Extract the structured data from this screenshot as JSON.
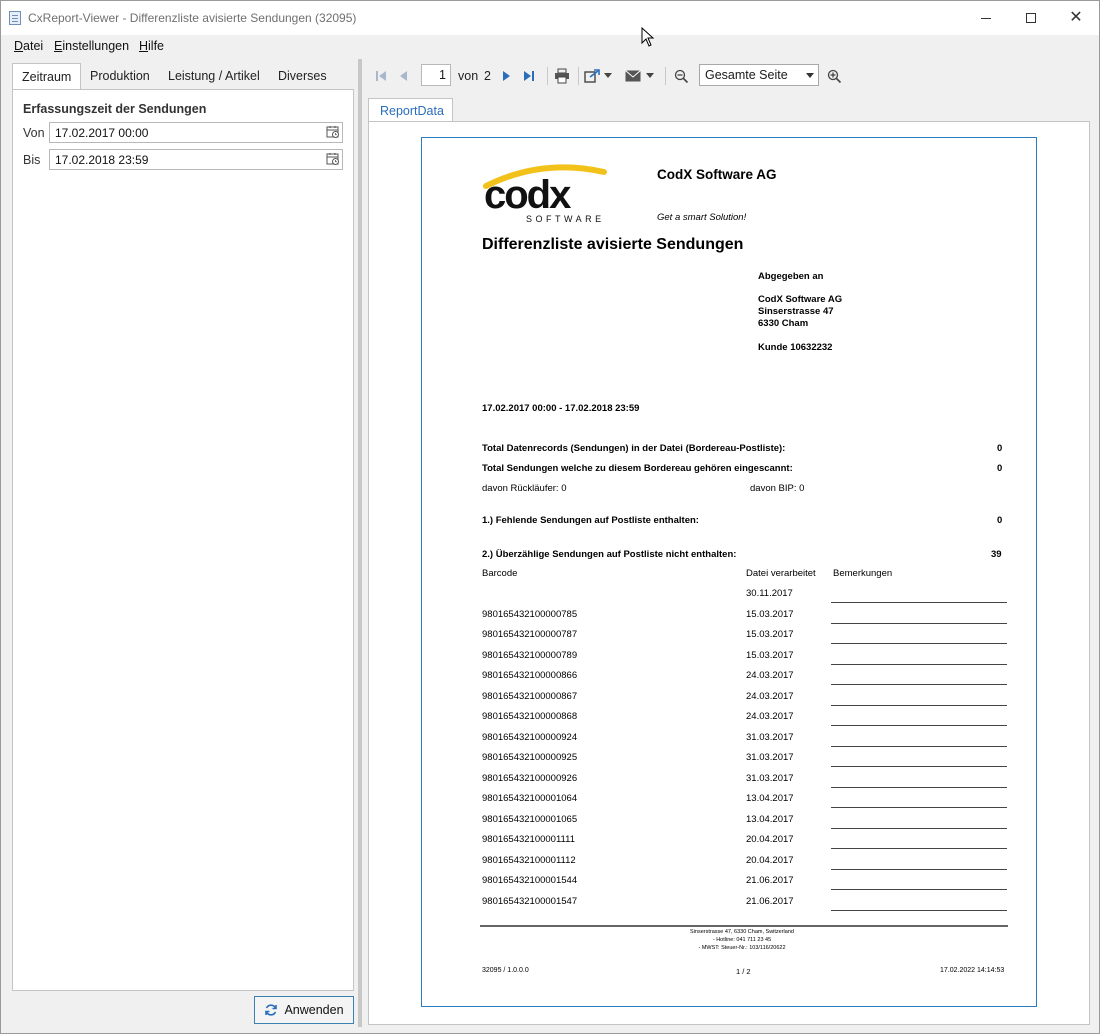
{
  "window": {
    "title": "CxReport-Viewer - Differenzliste avisierte Sendungen (32095)"
  },
  "menu": [
    "Datei",
    "Einstellungen",
    "Hilfe"
  ],
  "left": {
    "tabs": [
      "Zeitraum",
      "Produktion",
      "Leistung / Artikel",
      "Diverses"
    ],
    "group_title": "Erfassungszeit der Sendungen",
    "from_label": "Von",
    "from_value": "17.02.2017 00:00",
    "to_label": "Bis",
    "to_value": "17.02.2018 23:59",
    "apply_label": "Anwenden"
  },
  "toolbar": {
    "page_current": "1",
    "of_label": "von",
    "page_total": "2",
    "zoom_value": "Gesamte Seite"
  },
  "report_tab": "ReportData",
  "report": {
    "company": "CodX Software AG",
    "slogan": "Get a smart Solution!",
    "logo_text": "codx",
    "logo_sub": "SOFTWARE",
    "title": "Differenzliste avisierte Sendungen",
    "delivered_label": "Abgegeben an",
    "addr1": "CodX Software AG",
    "addr2": "Sinserstrasse 47",
    "addr3": "6330 Cham",
    "customer": "Kunde 10632232",
    "period": "17.02.2017 00:00 - 17.02.2018 23:59",
    "total_records_label": "Total Datenrecords (Sendungen) in der Datei (Bordereau-Postliste):",
    "total_records_value": "0",
    "total_scanned_label": "Total Sendungen welche zu diesem Bordereau gehören eingescannt:",
    "total_scanned_value": "0",
    "returns_label": "davon Rückläufer: 0",
    "bip_label": "davon BIP: 0",
    "missing_label": "1.) Fehlende Sendungen auf Postliste enthalten:",
    "missing_value": "0",
    "excess_label": "2.) Überzählige Sendungen auf Postliste nicht enthalten:",
    "excess_value": "39",
    "col_barcode": "Barcode",
    "col_date": "Datei verarbeitet",
    "col_remarks": "Bemerkungen",
    "rows": [
      {
        "barcode": "",
        "date": "30.11.2017"
      },
      {
        "barcode": "980165432100000785",
        "date": "15.03.2017"
      },
      {
        "barcode": "980165432100000787",
        "date": "15.03.2017"
      },
      {
        "barcode": "980165432100000789",
        "date": "15.03.2017"
      },
      {
        "barcode": "980165432100000866",
        "date": "24.03.2017"
      },
      {
        "barcode": "980165432100000867",
        "date": "24.03.2017"
      },
      {
        "barcode": "980165432100000868",
        "date": "24.03.2017"
      },
      {
        "barcode": "980165432100000924",
        "date": "31.03.2017"
      },
      {
        "barcode": "980165432100000925",
        "date": "31.03.2017"
      },
      {
        "barcode": "980165432100000926",
        "date": "31.03.2017"
      },
      {
        "barcode": "980165432100001064",
        "date": "13.04.2017"
      },
      {
        "barcode": "980165432100001065",
        "date": "13.04.2017"
      },
      {
        "barcode": "980165432100001111",
        "date": "20.04.2017"
      },
      {
        "barcode": "980165432100001112",
        "date": "20.04.2017"
      },
      {
        "barcode": "980165432100001544",
        "date": "21.06.2017"
      },
      {
        "barcode": "980165432100001547",
        "date": "21.06.2017"
      }
    ],
    "footer_line1": "Sinserstrasse 47, 6330 Cham, Switzerland",
    "footer_line2": "- Hotline: 041 711 23 45",
    "footer_line3": "- MWST: Steuer-Nr.: 103/116/20622",
    "footer_left": "32095 / 1.0.0.0",
    "footer_center": "1 / 2",
    "footer_right": "17.02.2022 14:14:53"
  }
}
